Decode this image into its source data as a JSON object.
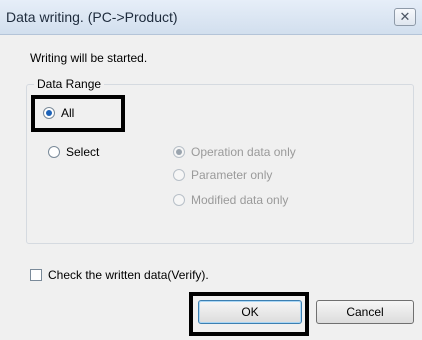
{
  "window": {
    "title": "Data writing. (PC->Product)",
    "close_icon": "close-icon"
  },
  "message": "Writing will be started.",
  "data_range": {
    "legend": "Data Range",
    "all_label": "All",
    "select_label": "Select",
    "options": [
      {
        "label": "Operation data only"
      },
      {
        "label": "Parameter only"
      },
      {
        "label": "Modified data only"
      }
    ]
  },
  "verify": {
    "label": "Check the written data(Verify)."
  },
  "buttons": {
    "ok_label": "OK",
    "cancel_label": "Cancel"
  },
  "colors": {
    "highlight": "#000000",
    "radio_accent": "#1c62b8"
  }
}
